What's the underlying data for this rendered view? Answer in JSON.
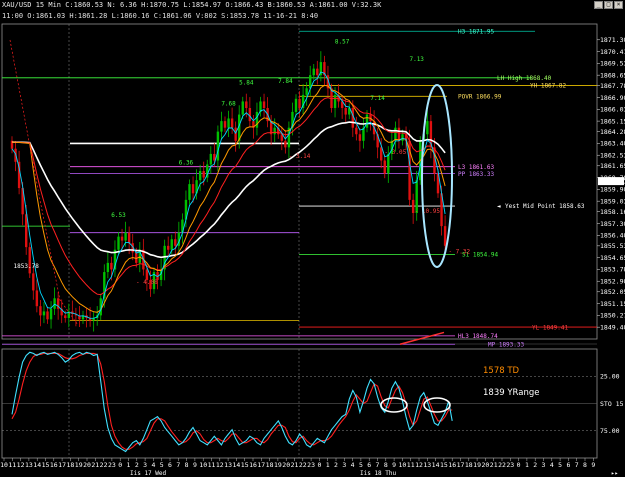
{
  "window": {
    "title": "XAU/USD 15 Min  C:1860.53  N:  6.36  H:1870.75  L:1854.97  O:1866.43  B:1860.53  A:1861.00  V:32.3K",
    "info": "11:00  O:1861.03  H:1861.28  L:1860.16  C:1861.06  V:802  S:1853.78  11-16-21  8:40"
  },
  "colors": {
    "background": "#000000",
    "bull": "#00c000",
    "bear": "#e01010",
    "white_ma": "#ffffff",
    "red_ma": "#ff2020",
    "orange_ma": "#ff9a00",
    "cyan_ma": "#00d8ff",
    "stoch_k": "#40e0ff",
    "stoch_d": "#ff2020",
    "ellipse": "#a8e6ff"
  },
  "chart_data": [
    {
      "type": "candlestick",
      "symbol": "XAU/USD",
      "timeframe": "15 Min",
      "ylim": [
        1848.5,
        1872.5
      ],
      "y_ticks": [
        1849.4,
        1850.3,
        1851.2,
        1852.1,
        1852.9,
        1853.8,
        1854.7,
        1855.6,
        1856.4,
        1857.3,
        1858.2,
        1859.0,
        1859.9,
        1860.8,
        1861.7,
        1862.5,
        1863.4,
        1864.3,
        1865.1,
        1866.0,
        1866.9,
        1867.8,
        1868.6,
        1869.5,
        1870.4,
        1871.3
      ],
      "y_tick_labels": [
        "1849.40",
        "1850.27",
        "1851.15",
        "1852.05",
        "1852.90",
        "1853.78",
        "1854.65",
        "1855.53",
        "1856.40",
        "1857.30",
        "1858.16",
        "1859.03",
        "1859.90",
        "1860.78",
        "1861.65",
        "1862.53",
        "1863.40",
        "1864.28",
        "1865.15",
        "1866.03",
        "1866.90",
        "1867.78",
        "1868.65",
        "1869.53",
        "1870.41",
        "1871.30"
      ],
      "current_price": 1860.53,
      "closes": [
        1863.0,
        1862.0,
        1860.0,
        1858.0,
        1855.5,
        1853.5,
        1852.2,
        1851.0,
        1850.3,
        1850.6,
        1850.0,
        1850.8,
        1851.6,
        1850.8,
        1850.3,
        1850.1,
        1850.6,
        1850.4,
        1850.3,
        1850.0,
        1850.3,
        1850.1,
        1849.9,
        1850.1,
        1850.3,
        1851.6,
        1853.6,
        1854.3,
        1853.8,
        1855.3,
        1856.3,
        1856.0,
        1856.6,
        1855.8,
        1855.1,
        1854.3,
        1855.3,
        1853.8,
        1853.0,
        1852.3,
        1853.6,
        1853.0,
        1853.8,
        1855.6,
        1855.3,
        1856.1,
        1855.6,
        1856.6,
        1857.6,
        1859.1,
        1860.3,
        1859.6,
        1860.6,
        1861.3,
        1860.8,
        1861.8,
        1862.6,
        1862.1,
        1864.3,
        1865.1,
        1864.6,
        1865.3,
        1864.6,
        1863.6,
        1865.6,
        1866.6,
        1866.1,
        1865.1,
        1864.6,
        1865.8,
        1866.6,
        1866.1,
        1865.1,
        1864.1,
        1864.6,
        1864.1,
        1863.6,
        1863.1,
        1864.6,
        1865.8,
        1866.8,
        1866.1,
        1867.1,
        1867.6,
        1868.6,
        1869.1,
        1868.6,
        1869.6,
        1868.6,
        1867.6,
        1866.1,
        1867.1,
        1866.6,
        1866.1,
        1865.6,
        1866.1,
        1864.6,
        1864.1,
        1863.6,
        1864.6,
        1865.6,
        1865.1,
        1864.1,
        1863.1,
        1862.1,
        1861.1,
        1862.6,
        1863.6,
        1864.6,
        1863.6,
        1864.1,
        1863.6,
        1859.1,
        1858.1,
        1860.6,
        1863.6,
        1864.1,
        1865.1,
        1863.1,
        1861.1,
        1859.6,
        1857.1,
        1855.6
      ],
      "lines": [
        {
          "label": "H3 1871.95",
          "price": 1871.95,
          "color": "#00c8a8",
          "text_color": "#40ffd0"
        },
        {
          "label": "LH High 1868.40",
          "price": 1868.4,
          "color": "#40ff40",
          "text_color": "#a0ff60"
        },
        {
          "label": "YH 1867.82",
          "price": 1867.82,
          "color": "#e8c000",
          "text_color": "#ffe060"
        },
        {
          "label": "POVR 1866.99",
          "price": 1866.99,
          "color": "#e8c000",
          "text_color": "#ffe060"
        },
        {
          "label": "L3 1861.63",
          "price": 1861.63,
          "color": "#ff60ff",
          "text_color": "#ff80ff"
        },
        {
          "label": "PP 1863.33",
          "price": 1861.1,
          "color": "#c060ff",
          "text_color": "#d080ff"
        },
        {
          "label": "Yest Mid Point 1858.63",
          "price": 1858.63,
          "color": "#ffffff",
          "text_color": "#ffffff"
        },
        {
          "label": "S1 1854.94",
          "price": 1854.94,
          "color": "#40ff40",
          "text_color": "#40ff40"
        },
        {
          "label": "YL 1849.41",
          "price": 1849.41,
          "color": "#ff2020",
          "text_color": "#ff4040"
        },
        {
          "label": "HL3 1848.74",
          "price": 1848.74,
          "color": "#ff60ff",
          "text_color": "#ff80ff"
        },
        {
          "label": "MP 1893.33",
          "price": 1848.1,
          "color": "#c060ff",
          "text_color": "#d080ff"
        }
      ],
      "annotations": [
        {
          "text": "1853.78",
          "price": 1853.9,
          "bar": 4,
          "color": "#ffffff"
        },
        {
          "text": "6.53",
          "price": 1857.8,
          "bar": 30,
          "color": "#40ff40"
        },
        {
          "text": "- 4.08",
          "price": 1852.7,
          "bar": 38,
          "color": "#ff4040"
        },
        {
          "text": "6.36",
          "price": 1861.8,
          "bar": 49,
          "color": "#40ff40"
        },
        {
          "text": "7.68",
          "price": 1866.3,
          "bar": 61,
          "color": "#40ff40"
        },
        {
          "text": "5.84",
          "price": 1867.9,
          "bar": 66,
          "color": "#40ff40"
        },
        {
          "text": "7.84",
          "price": 1868.0,
          "bar": 77,
          "color": "#40ff40"
        },
        {
          "text": "- 3.14",
          "price": 1862.3,
          "bar": 81,
          "color": "#ff4040"
        },
        {
          "text": "8.57",
          "price": 1871.0,
          "bar": 93,
          "color": "#40ff40"
        },
        {
          "text": "7.14",
          "price": 1866.7,
          "bar": 103,
          "color": "#40ff40"
        },
        {
          "text": "7.13",
          "price": 1869.7,
          "bar": 114,
          "color": "#40ff40"
        },
        {
          "text": "- 3.05",
          "price": 1862.6,
          "bar": 108,
          "color": "#ff4040"
        },
        {
          "text": "- 10.95",
          "price": 1858.1,
          "bar": 117,
          "color": "#ff4040"
        },
        {
          "text": "- 7.32",
          "price": 1855.0,
          "bar": 126,
          "color": "#ff4040"
        }
      ]
    },
    {
      "type": "line",
      "name": "STO 15",
      "ylim": [
        0,
        100
      ],
      "y_ticks": [
        25,
        50,
        75
      ],
      "y_tick_labels": [
        "25.00",
        "STO 15",
        "75.00"
      ],
      "k_values": [
        60,
        42,
        26,
        12,
        6,
        3,
        4,
        6,
        4,
        3,
        5,
        4,
        3,
        5,
        8,
        12,
        10,
        6,
        4,
        3,
        5,
        3,
        4,
        6,
        5,
        30,
        55,
        72,
        82,
        88,
        90,
        92,
        94,
        90,
        86,
        84,
        88,
        82,
        74,
        66,
        64,
        62,
        66,
        72,
        76,
        80,
        84,
        88,
        86,
        82,
        76,
        72,
        78,
        84,
        86,
        88,
        84,
        80,
        84,
        88,
        82,
        78,
        74,
        82,
        88,
        86,
        84,
        80,
        82,
        86,
        88,
        82,
        78,
        74,
        70,
        66,
        72,
        80,
        86,
        88,
        84,
        78,
        82,
        88,
        90,
        86,
        82,
        84,
        86,
        80,
        74,
        70,
        66,
        62,
        60,
        46,
        38,
        44,
        58,
        48,
        36,
        28,
        32,
        44,
        54,
        58,
        48,
        36,
        30,
        36,
        48,
        62,
        74,
        70,
        56,
        44,
        40,
        48,
        58,
        68,
        70,
        64,
        58,
        48,
        66
      ],
      "d_values": [
        64,
        58,
        46,
        32,
        20,
        12,
        7,
        5,
        5,
        4,
        4,
        4,
        4,
        4,
        6,
        8,
        9,
        9,
        8,
        6,
        5,
        4,
        4,
        4,
        5,
        14,
        30,
        52,
        70,
        80,
        86,
        90,
        92,
        92,
        90,
        87,
        86,
        85,
        82,
        75,
        68,
        64,
        64,
        66,
        71,
        76,
        80,
        84,
        86,
        85,
        82,
        77,
        75,
        78,
        83,
        86,
        86,
        84,
        82,
        84,
        85,
        82,
        78,
        78,
        82,
        86,
        86,
        84,
        82,
        82,
        85,
        86,
        83,
        78,
        74,
        70,
        70,
        72,
        80,
        85,
        86,
        82,
        80,
        84,
        87,
        88,
        86,
        84,
        84,
        83,
        80,
        75,
        70,
        66,
        62,
        56,
        48,
        42,
        46,
        50,
        48,
        40,
        32,
        34,
        44,
        52,
        54,
        46,
        38,
        34,
        40,
        50,
        62,
        70,
        66,
        56,
        46,
        44,
        52,
        60,
        66,
        66,
        62,
        56,
        56
      ],
      "annotations": [
        {
          "text": "1578 TD",
          "color": "#ff8c00"
        },
        {
          "text": "1839 YRange",
          "color": "#ffffff"
        }
      ]
    }
  ],
  "time_axis": {
    "labels": [
      "10",
      "11",
      "12",
      "13",
      "14",
      "15",
      "16",
      "17",
      "18",
      "19",
      "20",
      "21",
      "22",
      "23",
      "0",
      "1",
      "2",
      "3",
      "4",
      "5",
      "6",
      "7",
      "8",
      "9",
      "10",
      "11",
      "12",
      "13",
      "14",
      "15",
      "16",
      "17",
      "18",
      "19",
      "20",
      "21",
      "22",
      "23",
      "0",
      "1",
      "2",
      "3",
      "4",
      "5",
      "6",
      "7",
      "8",
      "9",
      "10",
      "11",
      "12",
      "13",
      "14",
      "15",
      "16",
      "17",
      "18",
      "19",
      "20",
      "21",
      "22",
      "23",
      "0",
      "1",
      "2",
      "3",
      "4",
      "5",
      "6",
      "7",
      "8",
      "9"
    ],
    "date_labels": [
      "Iis 17 Wed",
      "Iis 18 Thu"
    ]
  }
}
